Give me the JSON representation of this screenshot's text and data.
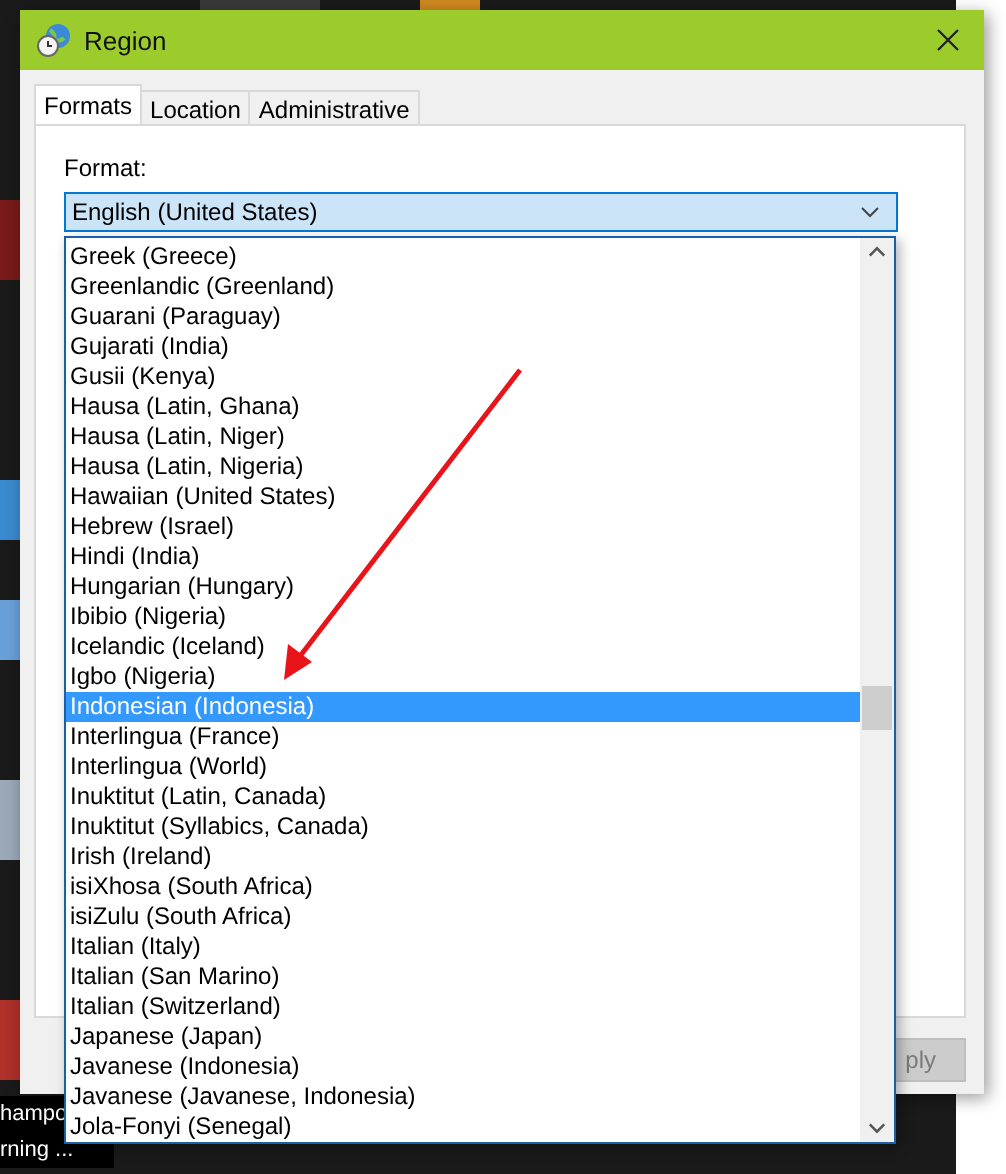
{
  "window": {
    "title": "Region"
  },
  "tabs": [
    {
      "label": "Formats",
      "selected": true
    },
    {
      "label": "Location",
      "selected": false
    },
    {
      "label": "Administrative",
      "selected": false
    }
  ],
  "format": {
    "label": "Format:",
    "value": "English (United States)",
    "expanded": true
  },
  "dropdown": {
    "items": [
      {
        "label": "Greek (Greece)",
        "selected": false
      },
      {
        "label": "Greenlandic (Greenland)",
        "selected": false
      },
      {
        "label": "Guarani (Paraguay)",
        "selected": false
      },
      {
        "label": "Gujarati (India)",
        "selected": false
      },
      {
        "label": "Gusii (Kenya)",
        "selected": false
      },
      {
        "label": "Hausa (Latin, Ghana)",
        "selected": false
      },
      {
        "label": "Hausa (Latin, Niger)",
        "selected": false
      },
      {
        "label": "Hausa (Latin, Nigeria)",
        "selected": false
      },
      {
        "label": "Hawaiian (United States)",
        "selected": false
      },
      {
        "label": "Hebrew (Israel)",
        "selected": false
      },
      {
        "label": "Hindi (India)",
        "selected": false
      },
      {
        "label": "Hungarian (Hungary)",
        "selected": false
      },
      {
        "label": "Ibibio (Nigeria)",
        "selected": false
      },
      {
        "label": "Icelandic (Iceland)",
        "selected": false
      },
      {
        "label": "Igbo (Nigeria)",
        "selected": false
      },
      {
        "label": "Indonesian (Indonesia)",
        "selected": true
      },
      {
        "label": "Interlingua (France)",
        "selected": false
      },
      {
        "label": "Interlingua (World)",
        "selected": false
      },
      {
        "label": "Inuktitut (Latin, Canada)",
        "selected": false
      },
      {
        "label": "Inuktitut (Syllabics, Canada)",
        "selected": false
      },
      {
        "label": "Irish (Ireland)",
        "selected": false
      },
      {
        "label": "isiXhosa (South Africa)",
        "selected": false
      },
      {
        "label": "isiZulu (South Africa)",
        "selected": false
      },
      {
        "label": "Italian (Italy)",
        "selected": false
      },
      {
        "label": "Italian (San Marino)",
        "selected": false
      },
      {
        "label": "Italian (Switzerland)",
        "selected": false
      },
      {
        "label": "Japanese (Japan)",
        "selected": false
      },
      {
        "label": "Javanese (Indonesia)",
        "selected": false
      },
      {
        "label": "Javanese (Javanese, Indonesia)",
        "selected": false
      },
      {
        "label": "Jola-Fonyi (Senegal)",
        "selected": false
      }
    ]
  },
  "apply_button": {
    "label": "ply",
    "disabled": true
  },
  "desktop": {
    "labels": [
      "hampo",
      "rning ..."
    ]
  }
}
